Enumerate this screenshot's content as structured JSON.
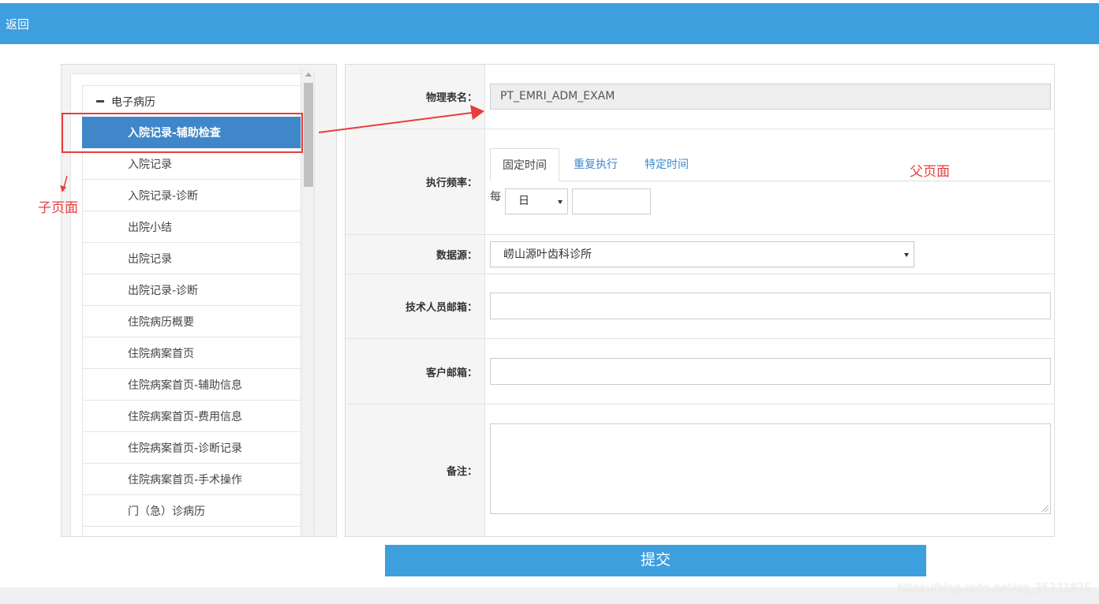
{
  "header": {
    "back_label": "返回"
  },
  "tree": {
    "root_label": "电子病历",
    "items": [
      {
        "label": "入院记录-辅助检查",
        "selected": true
      },
      {
        "label": "入院记录"
      },
      {
        "label": "入院记录-诊断"
      },
      {
        "label": "出院小结"
      },
      {
        "label": "出院记录"
      },
      {
        "label": "出院记录-诊断"
      },
      {
        "label": "住院病历概要"
      },
      {
        "label": "住院病案首页"
      },
      {
        "label": "住院病案首页-辅助信息"
      },
      {
        "label": "住院病案首页-费用信息"
      },
      {
        "label": "住院病案首页-诊断记录"
      },
      {
        "label": "住院病案首页-手术操作"
      },
      {
        "label": "门（急）诊病历"
      }
    ]
  },
  "annotations": {
    "child_page": "子页面",
    "parent_page": "父页面"
  },
  "form": {
    "table_name_label": "物理表名：",
    "table_name_value": "PT_EMRI_ADM_EXAM",
    "frequency_label": "执行频率：",
    "tabs": [
      "固定时间",
      "重复执行",
      "特定时间"
    ],
    "per_label": "每",
    "unit_value": "日",
    "datasource_label": "数据源：",
    "datasource_value": "崂山源叶齿科诊所",
    "tech_email_label": "技术人员邮箱：",
    "customer_email_label": "客户邮箱：",
    "notes_label": "备注："
  },
  "submit_label": "提交",
  "watermark": "https://blog.csdn.net/qq_25221835",
  "colors": {
    "header": "#3e9fde",
    "selected": "#3f87c8",
    "annotation": "#e83d3d",
    "link": "#3d8ad0"
  }
}
